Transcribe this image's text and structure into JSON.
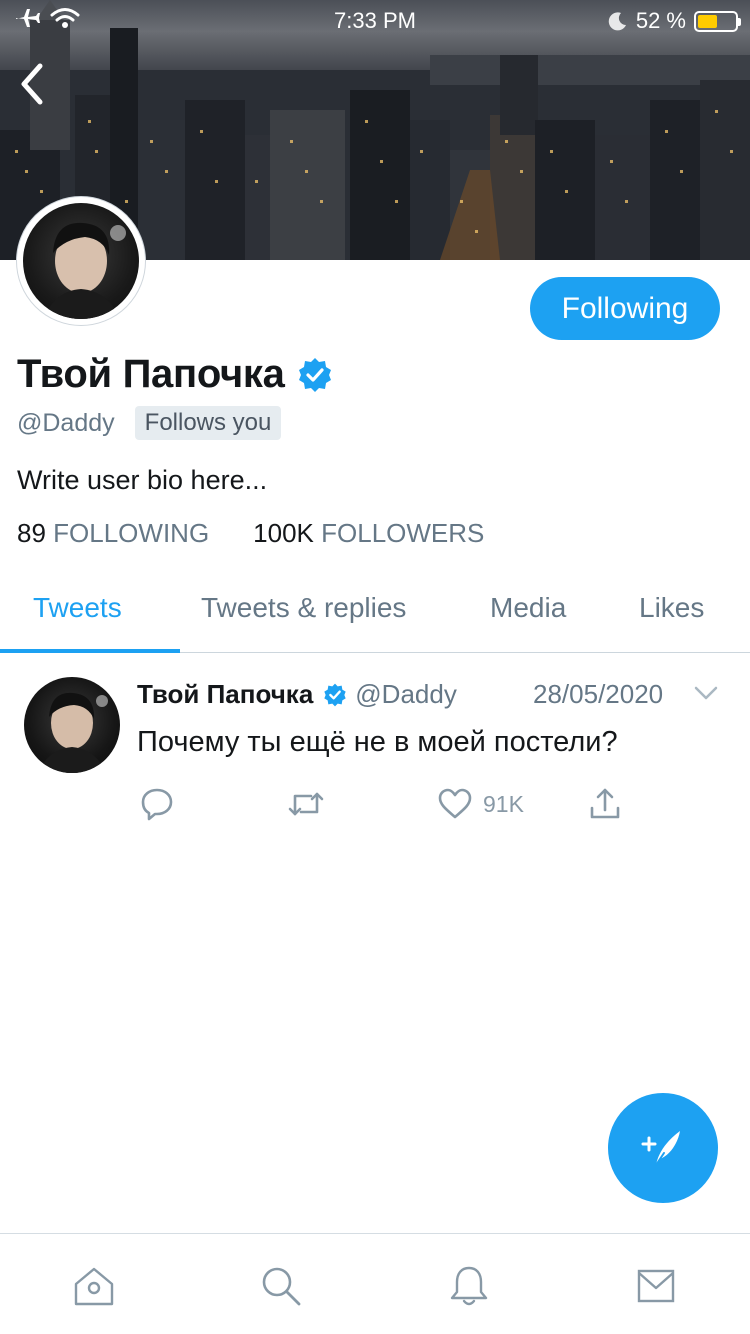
{
  "status_bar": {
    "time": "7:33 PM",
    "battery_percent": "52 %",
    "battery_level": 0.52,
    "battery_color": "#ffcc00"
  },
  "header": {
    "back_icon": "chevron-left-icon"
  },
  "profile": {
    "name": "Твой Папочка",
    "verified": true,
    "handle": "@Daddy",
    "follows_you": "Follows you",
    "bio": "Write user bio here...",
    "following_count": "89",
    "following_label": "FOLLOWING",
    "followers_count": "100K",
    "followers_label": "FOLLOWERS",
    "follow_button": "Following"
  },
  "tabs": [
    {
      "label": "Tweets",
      "active": true
    },
    {
      "label": "Tweets & replies",
      "active": false
    },
    {
      "label": "Media",
      "active": false
    },
    {
      "label": "Likes",
      "active": false
    }
  ],
  "tweet": {
    "name": "Твой Папочка",
    "handle": "@Daddy",
    "date": "28/05/2020",
    "text": "Почему ты ещё не в моей постели?",
    "likes": "91K"
  },
  "bottom_nav": [
    "home-icon",
    "search-icon",
    "notifications-icon",
    "messages-icon"
  ],
  "colors": {
    "accent": "#1da1f2",
    "secondary_text": "#657786",
    "action_icons": "#8899a6"
  }
}
